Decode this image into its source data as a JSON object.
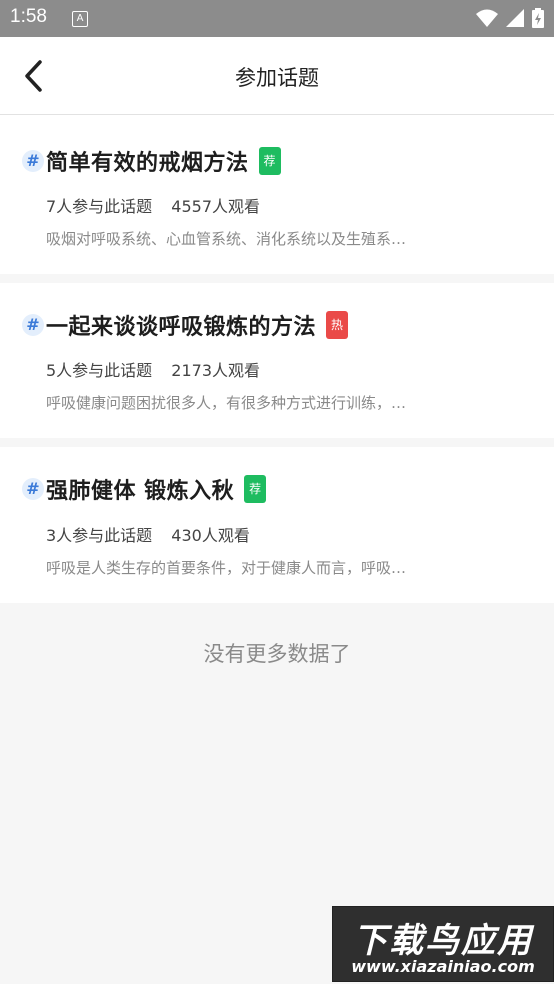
{
  "status_bar": {
    "time": "1:58",
    "notification_icon_letter": "A"
  },
  "header": {
    "title": "参加话题",
    "back_icon": "arrow-back-icon"
  },
  "topics": [
    {
      "title": "简单有效的戒烟方法",
      "badge": "荐",
      "badge_color": "#1ebc60",
      "participants": "7人参与此话题",
      "views": "4557人观看",
      "description": "吸烟对呼吸系统、心血管系统、消化系统以及生殖系…"
    },
    {
      "title": "一起来谈谈呼吸锻炼的方法",
      "badge": "热",
      "badge_color": "#ea4a48",
      "participants": "5人参与此话题",
      "views": "2173人观看",
      "description": "呼吸健康问题困扰很多人，有很多种方式进行训练，…"
    },
    {
      "title": "强肺健体 锻炼入秋",
      "badge": "荐",
      "badge_color": "#1ebc60",
      "participants": "3人参与此话题",
      "views": "430人观看",
      "description": "呼吸是人类生存的首要条件，对于健康人而言，呼吸…"
    }
  ],
  "footer": {
    "no_more": "没有更多数据了"
  },
  "watermark": {
    "main": "下载鸟应用",
    "sub": "www.xiazainiao.com"
  }
}
